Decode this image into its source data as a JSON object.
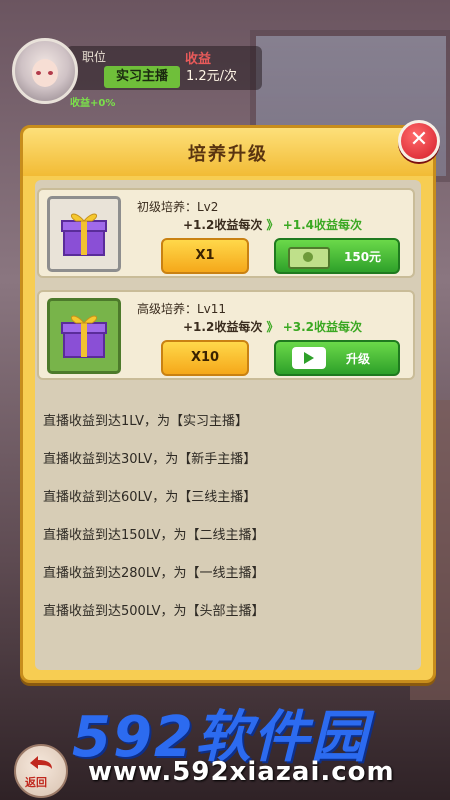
{
  "header": {
    "job_label": "职位",
    "income_label": "收益",
    "job_value": "实习主播",
    "income_value": "1.2元/次",
    "bonus": "收益+0%"
  },
  "dialog": {
    "title": "培养升级",
    "close_icon": "close-icon",
    "cards": [
      {
        "name": "初级培养：Lv2",
        "gain_current": "+1.2收益每次",
        "arrow": "》",
        "gain_next": "+1.4收益每次",
        "multiplier": "X1",
        "action_label": "150元",
        "action_icon": "money-icon",
        "gift_icon": "gift-box-icon"
      },
      {
        "name": "高级培养：Lv11",
        "gain_current": "+1.2收益每次",
        "arrow": "》",
        "gain_next": "+3.2收益每次",
        "multiplier": "X10",
        "action_label": "升级",
        "action_icon": "video-icon",
        "gift_icon": "gift-box-icon"
      }
    ],
    "milestones": [
      "直播收益到达1LV，为【实习主播】",
      "直播收益到达30LV，为【新手主播】",
      "直播收益到达60LV，为【三线主播】",
      "直播收益到达150LV，为【二线主播】",
      "直播收益到达280LV，为【一线主播】",
      "直播收益到达500LV，为【头部主播】"
    ]
  },
  "watermark": {
    "brand": "592软件园",
    "url": "www.592xiazai.com"
  },
  "back": {
    "label": "返回"
  },
  "colors": {
    "dialog_bg": "#f7cd52",
    "green_button": "#2ea02a",
    "gain_up": "#3aa822",
    "close_red": "#d41e2a"
  }
}
